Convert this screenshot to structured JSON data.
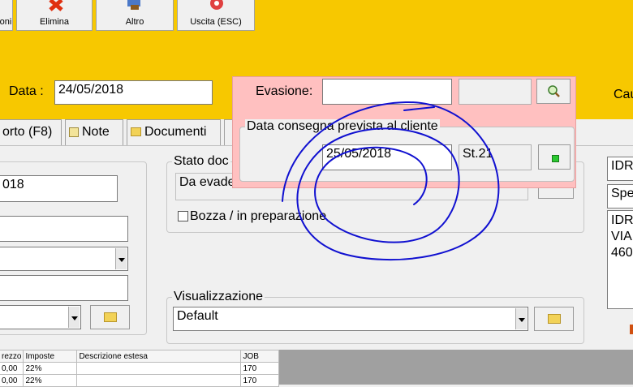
{
  "toolbar": {
    "partial_label": "oni",
    "delete_label": "Elimina",
    "other_label": "Altro",
    "exit_label": "Uscita (ESC)"
  },
  "header": {
    "date_label": "Data :",
    "date_value": "24/05/2018",
    "right_label": "Cau"
  },
  "evasion": {
    "label": "Evasione:",
    "value": "",
    "second_value": "",
    "group_title": "Data consegna prevista al cliente",
    "delivery_date": "25/05/2018",
    "status": "St.21"
  },
  "tabs": [
    {
      "label": "orto (F8)"
    },
    {
      "label": "Note"
    },
    {
      "label": "Documenti"
    }
  ],
  "left": {
    "field1_value": "018"
  },
  "stato": {
    "title": "Stato doc",
    "value": "Da evade",
    "draft_label": "Bozza / in preparazione"
  },
  "visual": {
    "title": "Visualizzazione",
    "value": "Default"
  },
  "right_panel": {
    "field1": "IDR",
    "field2": "Spe",
    "address_lines": [
      "IDR",
      "VIA",
      "460"
    ]
  },
  "table": {
    "columns": [
      "rezzo",
      "Imposte",
      "Descrizione estesa",
      "JOB"
    ],
    "rows": [
      [
        "0,00",
        "22%",
        "",
        "170"
      ],
      [
        "0,00",
        "22%",
        "",
        "170"
      ]
    ]
  },
  "colors": {
    "accent": "#f7c800",
    "popup_bg": "#ffc0c0",
    "annotation": "#1010d0"
  }
}
